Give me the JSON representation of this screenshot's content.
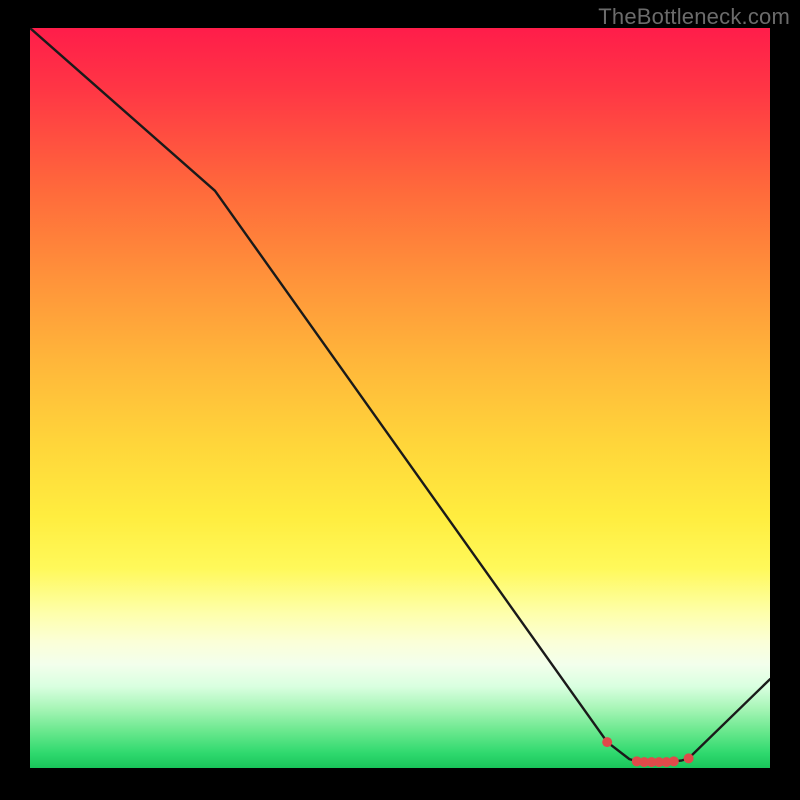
{
  "attribution": "TheBottleneck.com",
  "chart_data": {
    "type": "line",
    "title": "",
    "xlabel": "",
    "ylabel": "",
    "xlim": [
      0,
      100
    ],
    "ylim": [
      0,
      100
    ],
    "series": [
      {
        "name": "curve",
        "x": [
          0,
          25,
          78,
          81,
          82,
          83,
          84,
          85,
          86,
          87,
          88,
          89,
          100
        ],
        "values": [
          100,
          78,
          3.5,
          1.2,
          0.9,
          0.8,
          0.8,
          0.8,
          0.8,
          0.9,
          1.0,
          1.3,
          12
        ]
      },
      {
        "name": "markers",
        "x": [
          78,
          82,
          83,
          84,
          85,
          86,
          87,
          89
        ],
        "values": [
          3.5,
          0.9,
          0.8,
          0.8,
          0.8,
          0.8,
          0.9,
          1.3
        ]
      }
    ],
    "colors": {
      "line": "#1a1a1a",
      "marker": "#e04a4a",
      "gradient_top": "#ff1d4a",
      "gradient_bottom": "#19c45a"
    }
  }
}
